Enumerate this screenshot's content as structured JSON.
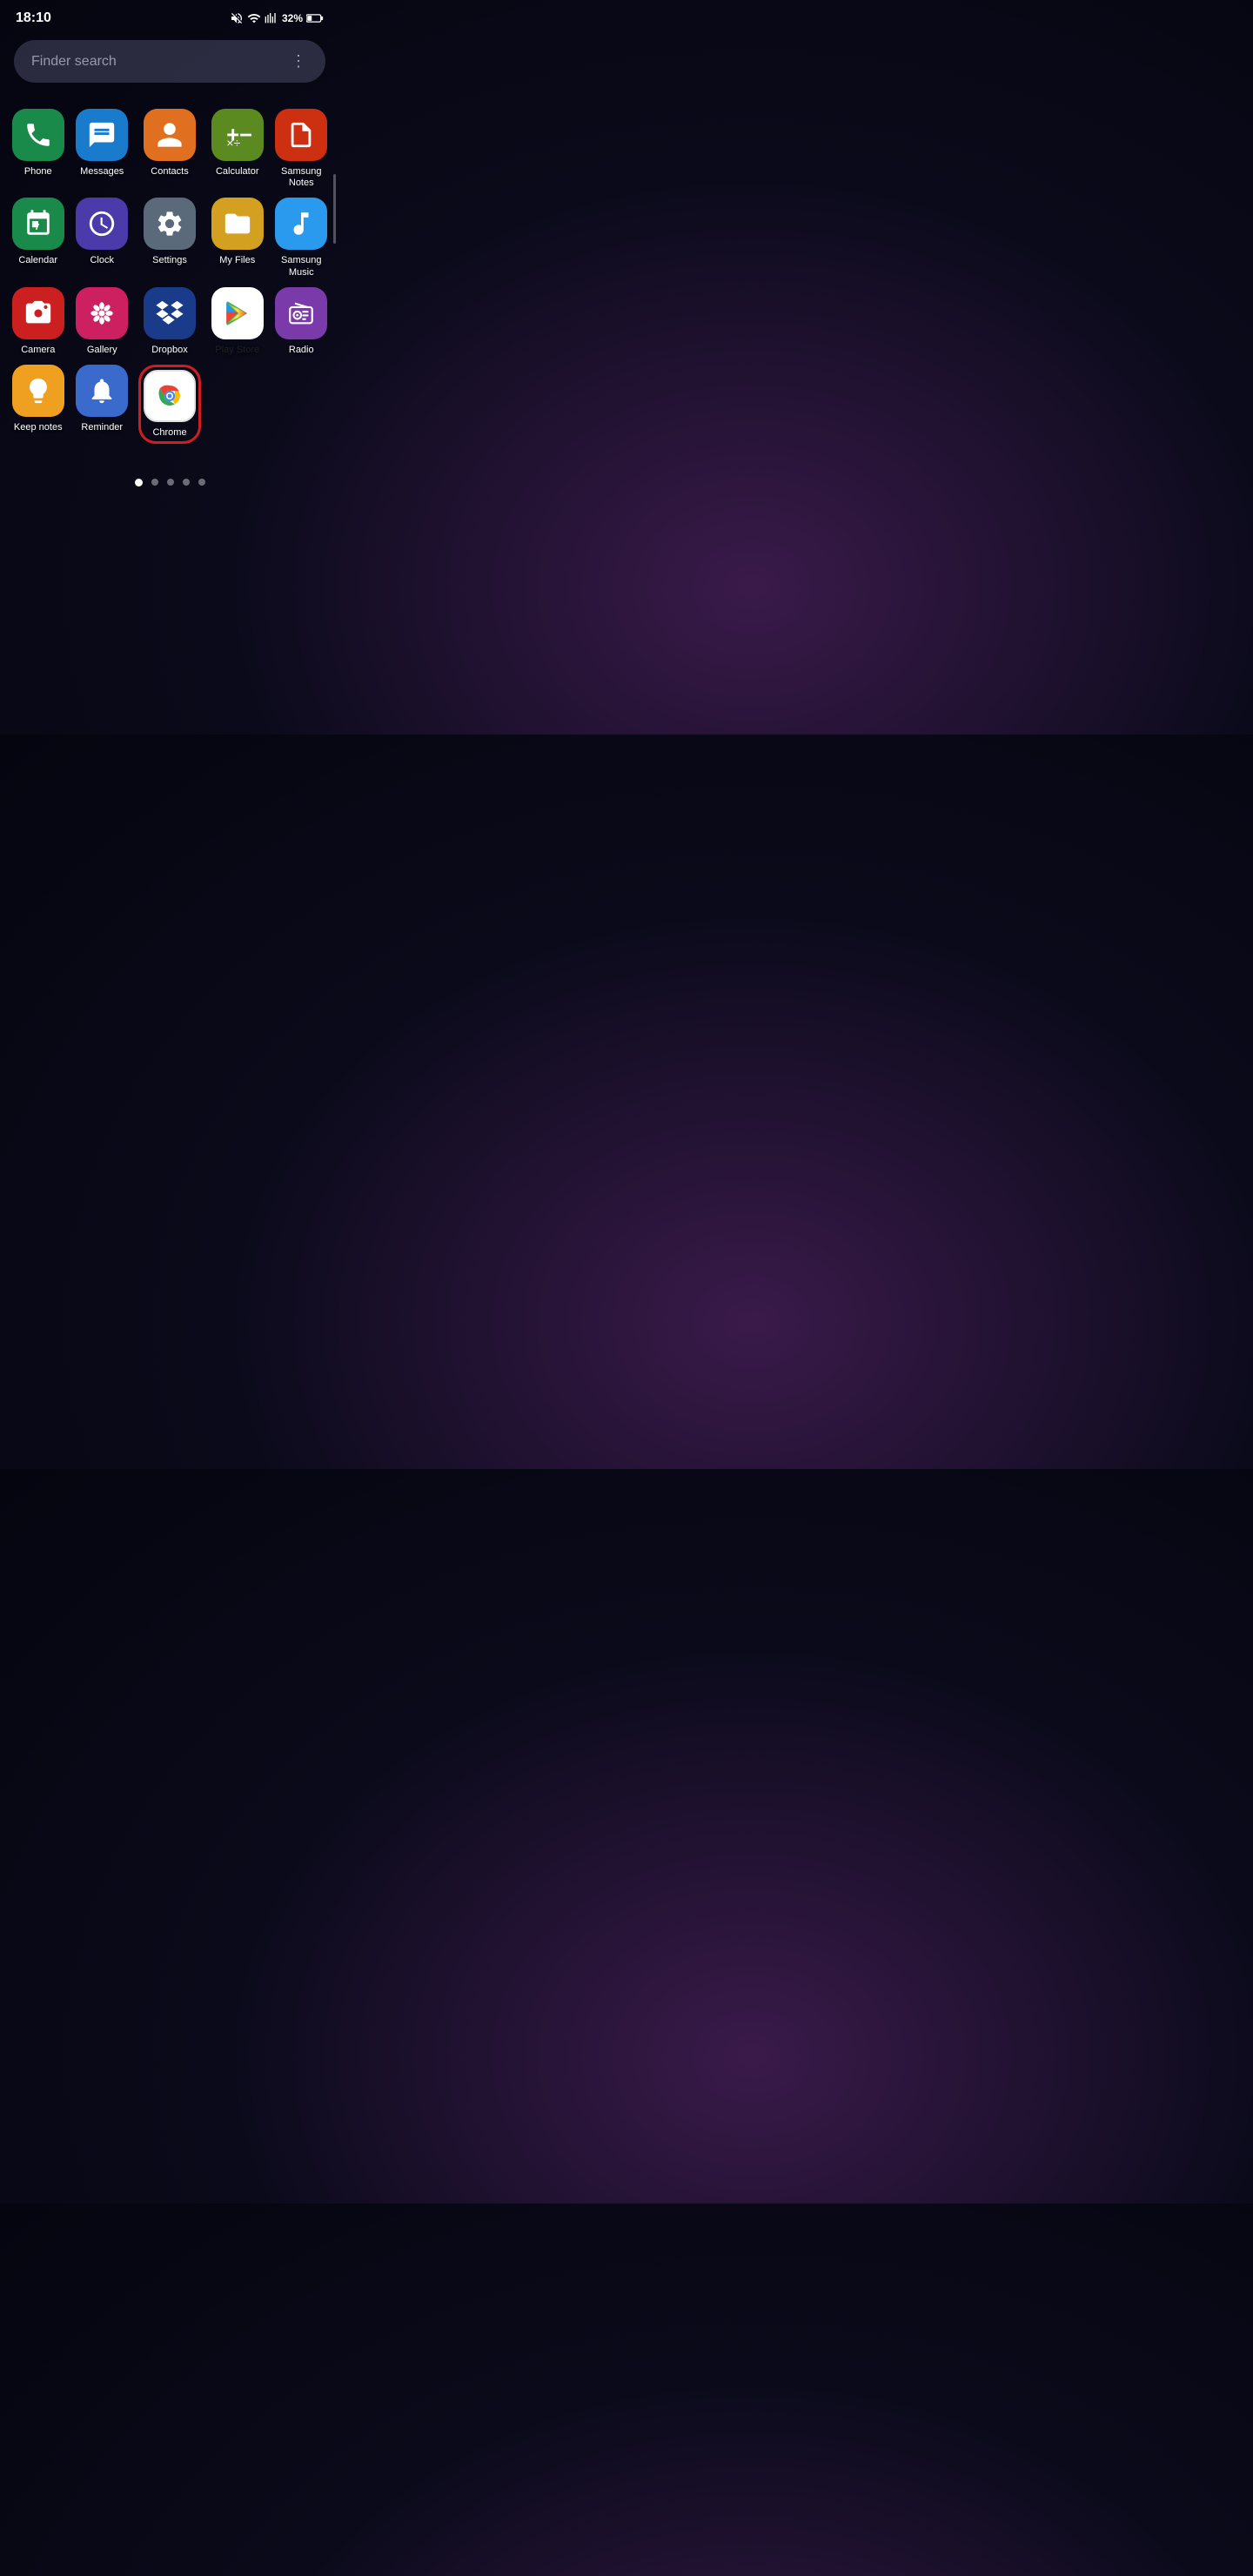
{
  "statusBar": {
    "time": "18:10",
    "battery": "32%",
    "batteryIcon": "🔋"
  },
  "searchBar": {
    "placeholder": "Finder search"
  },
  "pageIndicator": {
    "total": 5,
    "active": 0
  },
  "apps": [
    {
      "id": "phone",
      "label": "Phone",
      "iconClass": "icon-phone",
      "iconType": "phone"
    },
    {
      "id": "messages",
      "label": "Messages",
      "iconClass": "icon-messages",
      "iconType": "messages"
    },
    {
      "id": "contacts",
      "label": "Contacts",
      "iconClass": "icon-contacts",
      "iconType": "contacts"
    },
    {
      "id": "calculator",
      "label": "Calculator",
      "iconClass": "icon-calculator",
      "iconType": "calculator"
    },
    {
      "id": "samsung-notes",
      "label": "Samsung Notes",
      "iconClass": "icon-samsung-notes",
      "iconType": "notes"
    },
    {
      "id": "calendar",
      "label": "Calendar",
      "iconClass": "icon-calendar",
      "iconType": "calendar"
    },
    {
      "id": "clock",
      "label": "Clock",
      "iconClass": "icon-clock",
      "iconType": "clock"
    },
    {
      "id": "settings",
      "label": "Settings",
      "iconClass": "icon-settings",
      "iconType": "settings"
    },
    {
      "id": "myfiles",
      "label": "My Files",
      "iconClass": "icon-myfiles",
      "iconType": "files"
    },
    {
      "id": "samsung-music",
      "label": "Samsung Music",
      "iconClass": "icon-samsung-music",
      "iconType": "music"
    },
    {
      "id": "camera",
      "label": "Camera",
      "iconClass": "icon-camera",
      "iconType": "camera"
    },
    {
      "id": "gallery",
      "label": "Gallery",
      "iconClass": "icon-gallery",
      "iconType": "gallery"
    },
    {
      "id": "dropbox",
      "label": "Dropbox",
      "iconClass": "icon-dropbox",
      "iconType": "dropbox"
    },
    {
      "id": "playstore",
      "label": "Play Store",
      "iconClass": "icon-playstore",
      "iconType": "playstore"
    },
    {
      "id": "radio",
      "label": "Radio",
      "iconClass": "icon-radio",
      "iconType": "radio"
    },
    {
      "id": "keepnotes",
      "label": "Keep notes",
      "iconClass": "icon-keepnotes",
      "iconType": "keep"
    },
    {
      "id": "reminder",
      "label": "Reminder",
      "iconClass": "icon-reminder",
      "iconType": "reminder"
    },
    {
      "id": "chrome",
      "label": "Chrome",
      "iconClass": "icon-chrome",
      "iconType": "chrome",
      "highlighted": true
    }
  ]
}
